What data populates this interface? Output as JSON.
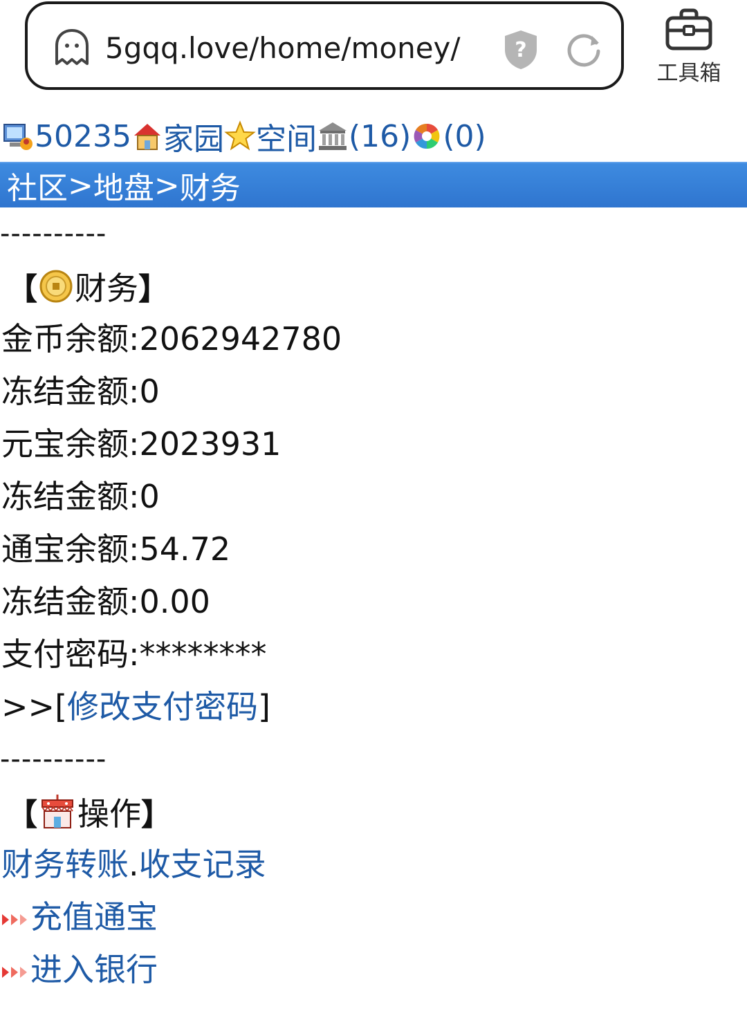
{
  "browser": {
    "url": "5gqq.love/home/money/",
    "toolbox_label": "工具箱"
  },
  "nav": {
    "user_id": "50235",
    "home_label": "家园",
    "space_label": "空间",
    "bank_count": "(16)",
    "message_count": "(0)"
  },
  "breadcrumb": {
    "community": "社区",
    "sep1": ">",
    "territory": "地盘",
    "sep2": ">",
    "finance": "财务"
  },
  "divider": "----------",
  "finance_section": {
    "open": "【",
    "title": "财务",
    "close": "】",
    "rows": [
      {
        "label": "金币余额:",
        "value": "2062942780"
      },
      {
        "label": "冻结金额:",
        "value": "0"
      },
      {
        "label": "元宝余额:",
        "value": "2023931"
      },
      {
        "label": "冻结金额:",
        "value": "0"
      },
      {
        "label": "通宝余额:",
        "value": "54.72"
      },
      {
        "label": "冻结金额:",
        "value": "0.00"
      },
      {
        "label": "支付密码:",
        "value": "********"
      }
    ],
    "change_prefix": ">>[",
    "change_link": "修改支付密码",
    "change_suffix": "]"
  },
  "ops_section": {
    "open": "【",
    "title": "操作",
    "close": "】",
    "transfer_link": "财务转账",
    "dot": ".",
    "records_link": "收支记录",
    "recharge_link": "充值通宝",
    "bank_link": "进入银行"
  }
}
